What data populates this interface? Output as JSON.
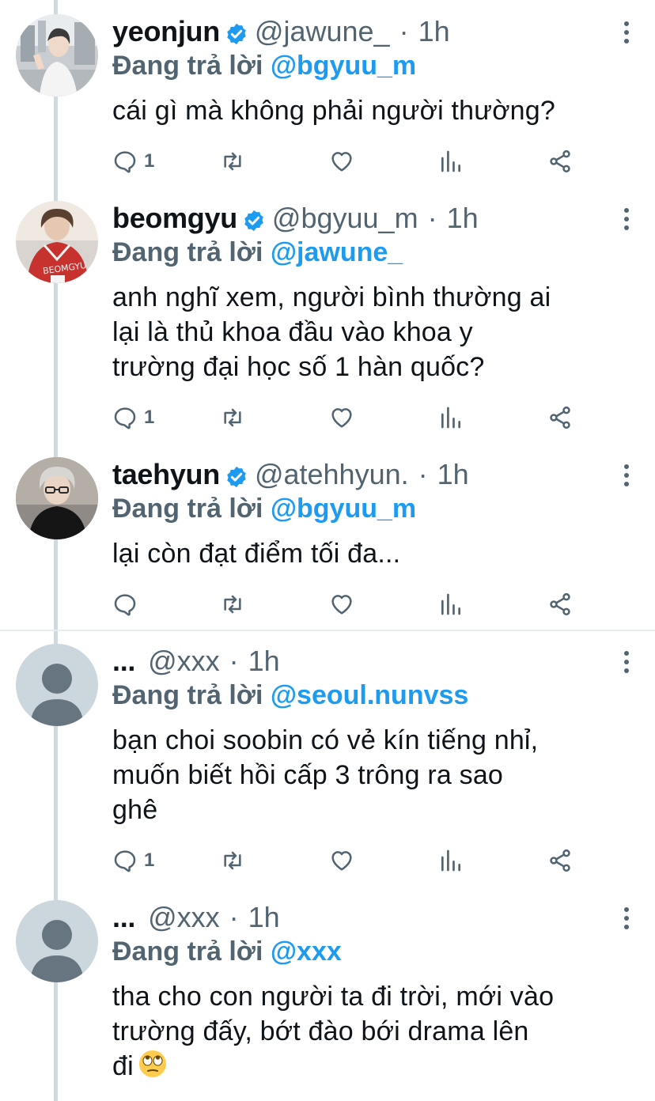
{
  "colors": {
    "text": "#0f1419",
    "secondary": "#536471",
    "accent": "#1d9bf0",
    "thread_line": "#cfd9de",
    "verified": "#1d9bf0"
  },
  "reply_prefix": "Đang trả lời",
  "tweets": [
    {
      "name": "yeonjun",
      "verified": true,
      "handle": "@jawune_",
      "time": "1h",
      "reply_to": "@bgyuu_m",
      "lines": [
        "cái gì mà không phải người thường?"
      ],
      "reply_count": "1"
    },
    {
      "name": "beomgyu",
      "verified": true,
      "handle": "@bgyuu_m",
      "time": "1h",
      "reply_to": "@jawune_",
      "lines": [
        "anh nghĩ xem, người bình thường ai",
        "lại là thủ khoa đầu vào khoa y",
        "trường đại học số 1 hàn quốc?"
      ],
      "reply_count": "1"
    },
    {
      "name": "taehyun",
      "verified": true,
      "handle": "@atehhyun.",
      "time": "1h",
      "reply_to": "@bgyuu_m",
      "lines": [
        "lại còn đạt điểm tối đa..."
      ],
      "reply_count": ""
    },
    {
      "name": "...",
      "verified": false,
      "handle": "@xxx",
      "time": "1h",
      "reply_to": "@seoul.nunvss",
      "lines": [
        "bạn choi soobin có vẻ kín tiếng nhỉ,",
        "muốn biết hồi cấp 3 trông ra sao",
        "ghê"
      ],
      "reply_count": "1"
    },
    {
      "name": "...",
      "verified": false,
      "handle": "@xxx",
      "time": "1h",
      "reply_to": "@xxx",
      "lines": [
        "tha cho con người ta đi trời, mới vào",
        "trường đấy, bớt đào bới drama lên",
        "đi"
      ],
      "reply_count": "",
      "trailing_emoji": "face-with-rolling-eyes-emoji"
    }
  ]
}
